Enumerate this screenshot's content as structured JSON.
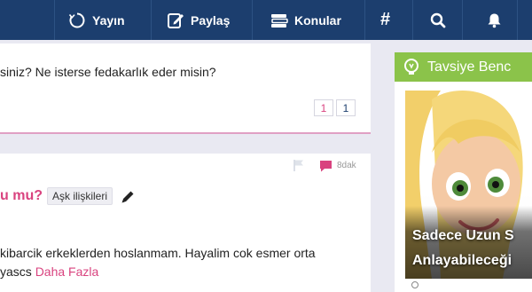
{
  "nav": {
    "items": [
      {
        "label": "Yayın",
        "icon": "refresh-circle-icon"
      },
      {
        "label": "Paylaş",
        "icon": "edit-square-icon"
      },
      {
        "label": "Konular",
        "icon": "books-stack-icon"
      }
    ],
    "hash_icon": "hashtag-icon",
    "search_icon": "search-icon",
    "bell_icon": "bell-icon"
  },
  "post1": {
    "question": "siniz? Ne isterse fedakarlık eder misin?",
    "pages": [
      "1",
      "1"
    ]
  },
  "post2": {
    "time": "8dak",
    "title": "u mu?",
    "tag": "Aşk ilişkileri",
    "body": "kibarcik erkeklerden hoslanmam. Hayalim cok esmer orta",
    "body_line2": "yascs ",
    "more": "Daha Fazla"
  },
  "sidebar": {
    "header": "Tavsiye Benc",
    "caption_line1": "Sadece Uzun S",
    "caption_line2": "Anlayabileceği"
  },
  "colors": {
    "nav_bg": "#1c3e6e",
    "accent_pink": "#d9437f",
    "green": "#8bc34a"
  }
}
